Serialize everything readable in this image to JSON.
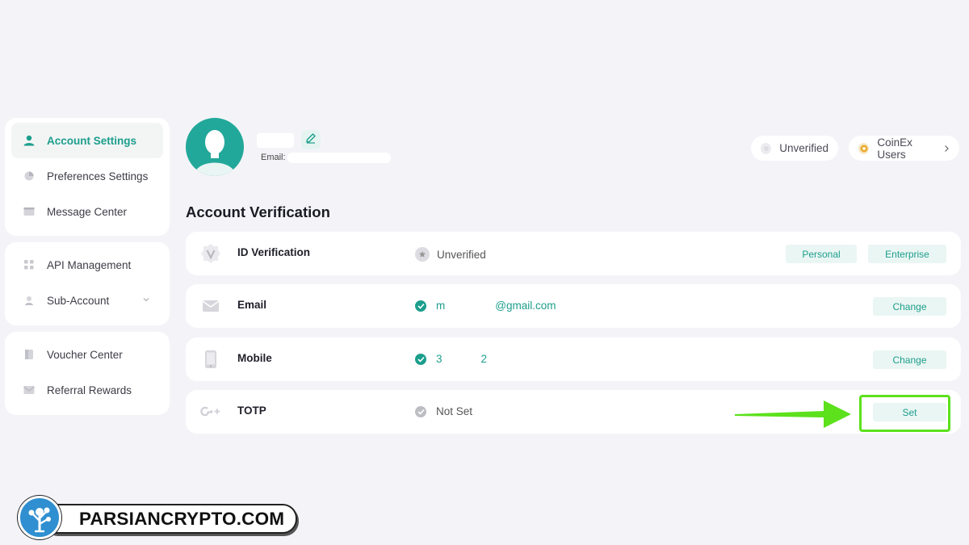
{
  "sidebar": {
    "group1": [
      {
        "label": "Account Settings",
        "icon": "user-icon",
        "active": true
      },
      {
        "label": "Preferences Settings",
        "icon": "preferences-icon"
      },
      {
        "label": "Message Center",
        "icon": "message-icon"
      }
    ],
    "group2": [
      {
        "label": "API Management",
        "icon": "api-icon"
      },
      {
        "label": "Sub-Account",
        "icon": "sub-account-icon"
      }
    ],
    "group3": [
      {
        "label": "Voucher Center",
        "icon": "voucher-icon"
      },
      {
        "label": "Referral Rewards",
        "icon": "referral-icon"
      }
    ]
  },
  "profile": {
    "email_label": "Email:",
    "verification_badge": "Unverified",
    "user_tier": "CoinEx Users"
  },
  "verification": {
    "title": "Account Verification",
    "rows": [
      {
        "label": "ID Verification",
        "icon": "id-verification-icon",
        "status": "Unverified",
        "buttons": [
          "Personal",
          "Enterprise"
        ]
      },
      {
        "label": "Email",
        "icon": "envelope-icon",
        "status_a": "m",
        "status_b": "@gmail.com",
        "button": "Change"
      },
      {
        "label": "Mobile",
        "icon": "phone-icon",
        "status_a": "3",
        "status_b": "2",
        "button": "Change"
      },
      {
        "label": "TOTP",
        "icon": "google-authenticator-icon",
        "status": "Not Set",
        "button": "Set"
      }
    ]
  },
  "watermark": {
    "text": "PARSIANCRYPTO.COM"
  },
  "colors": {
    "accent": "#1c9e8c",
    "highlight": "#5ce11c",
    "background": "#f4f4f8"
  }
}
